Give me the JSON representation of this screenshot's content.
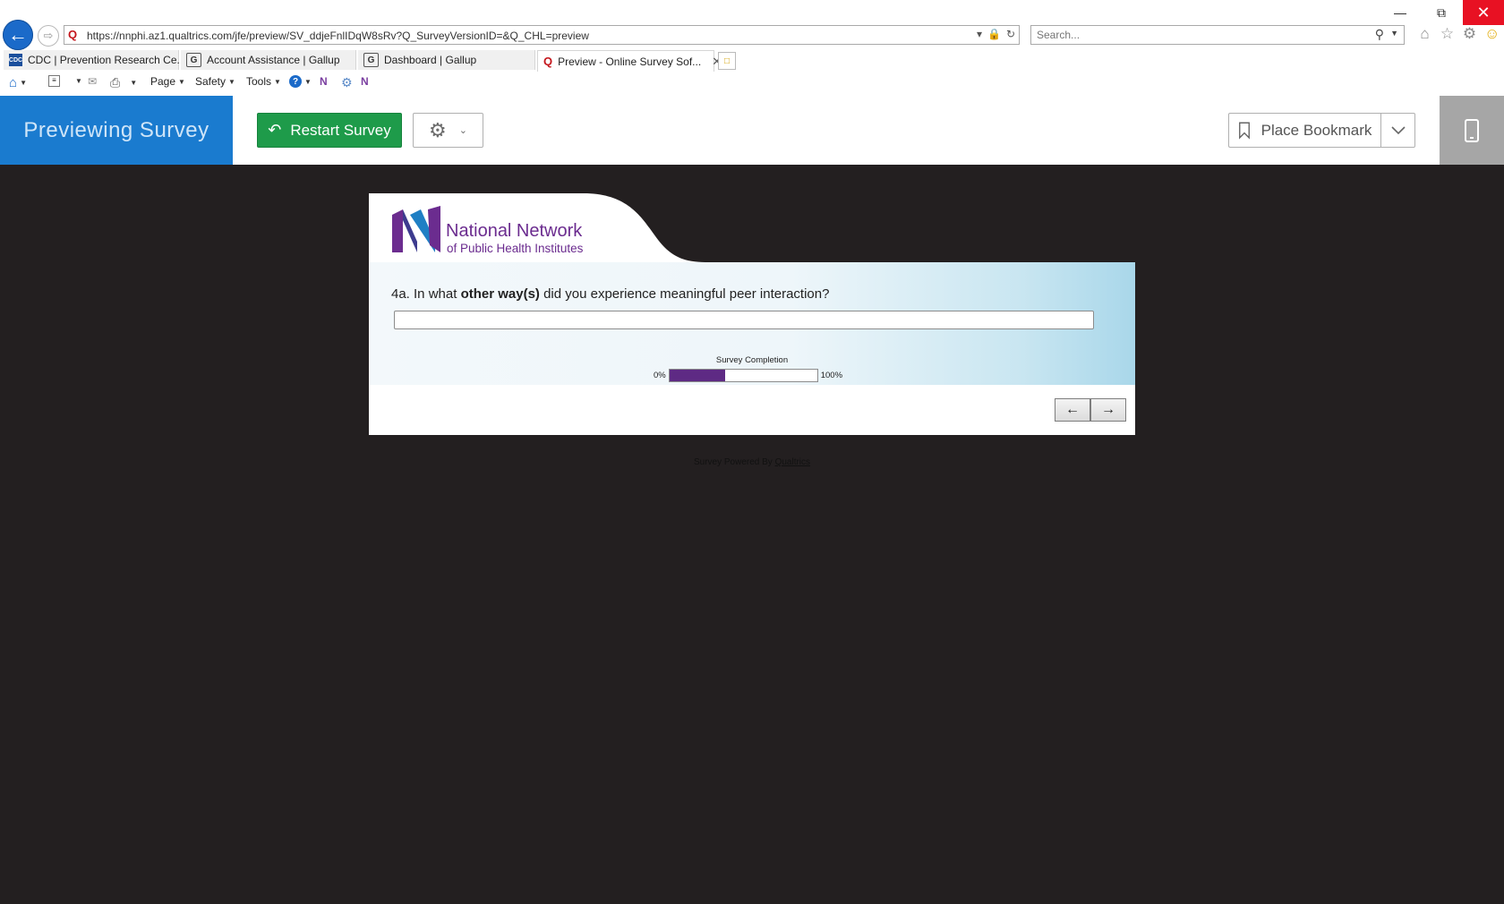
{
  "browser": {
    "url": "https://nnphi.az1.qualtrics.com/jfe/preview/SV_ddjeFnlIDqW8sRv?Q_SurveyVersionID=&Q_CHL=preview",
    "search_placeholder": "Search...",
    "tabs": [
      {
        "label": "CDC | Prevention Research Ce...",
        "icon": "cdc-icon"
      },
      {
        "label": "Account Assistance | Gallup",
        "icon": "gallup-icon"
      },
      {
        "label": "Dashboard | Gallup",
        "icon": "gallup-icon"
      },
      {
        "label": "Preview - Online Survey Sof...",
        "icon": "qualtrics-icon",
        "active": true
      }
    ],
    "commands": {
      "page": "Page",
      "safety": "Safety",
      "tools": "Tools"
    }
  },
  "preview_bar": {
    "title": "Previewing Survey",
    "restart_label": "Restart Survey",
    "bookmark_label": "Place Bookmark",
    "colors": {
      "title_bg": "#1a7bcf",
      "restart_bg": "#1e9b4a"
    }
  },
  "survey": {
    "logo": {
      "line1": "National Network",
      "line2": "of Public Health Institutes"
    },
    "question": {
      "prefix": "4a. In what ",
      "emphasis": "other way(s)",
      "suffix": " did you experience meaningful peer interaction?"
    },
    "answer_value": "",
    "progress": {
      "label": "Survey Completion",
      "min_label": "0%",
      "max_label": "100%",
      "percent": 38,
      "color": "#5e2a84"
    },
    "nav": {
      "back": "←",
      "next": "→"
    },
    "footer_prefix": "Survey Powered By ",
    "footer_link": "Qualtrics"
  }
}
